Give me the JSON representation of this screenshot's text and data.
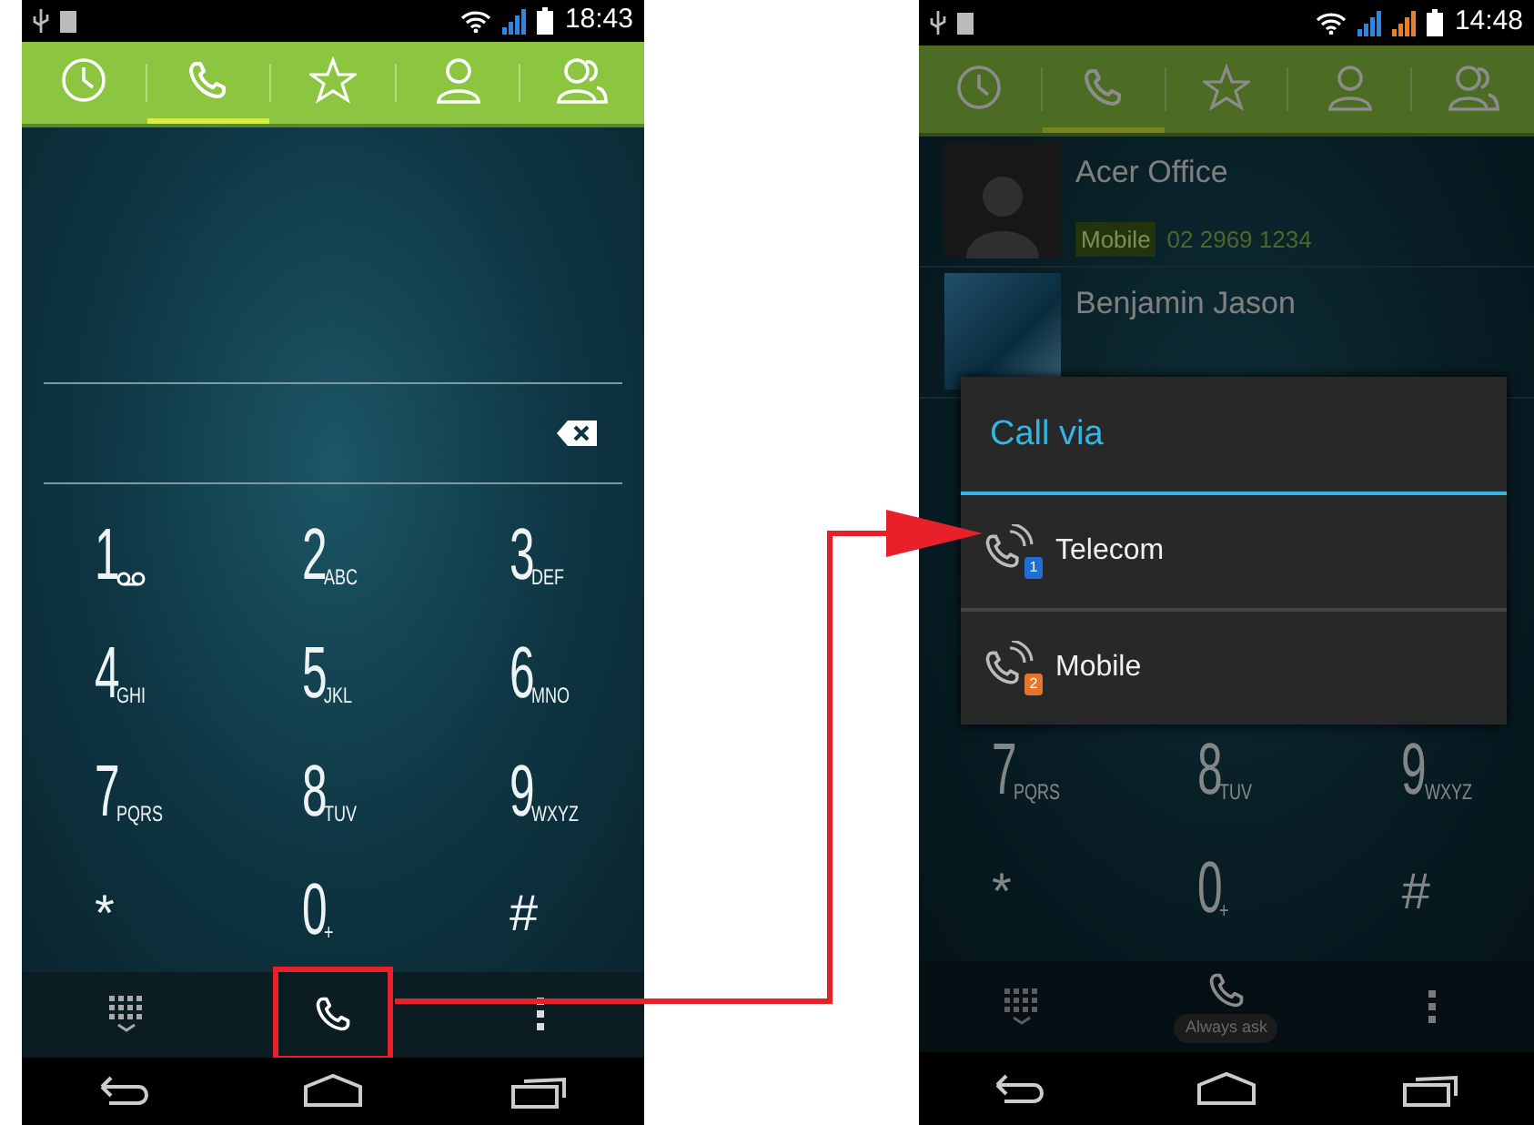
{
  "phones": [
    {
      "dimmed": false,
      "status_bar": {
        "time": "18:43",
        "signals": [
          {
            "color": "#2f86e0"
          }
        ]
      },
      "tabs": [
        {
          "kind": "recent",
          "selected": false
        },
        {
          "kind": "phone",
          "selected": true
        },
        {
          "kind": "favorites",
          "selected": false
        },
        {
          "kind": "contact",
          "selected": false
        },
        {
          "kind": "group",
          "selected": false
        }
      ],
      "keypad": [
        {
          "kind": "voicemail",
          "digit": "1"
        },
        {
          "kind": "letters",
          "digit": "2",
          "letters": "ABC"
        },
        {
          "kind": "letters",
          "digit": "3",
          "letters": "DEF"
        },
        {
          "kind": "letters",
          "digit": "4",
          "letters": "GHI"
        },
        {
          "kind": "letters",
          "digit": "5",
          "letters": "JKL"
        },
        {
          "kind": "letters",
          "digit": "6",
          "letters": "MNO"
        },
        {
          "kind": "letters",
          "digit": "7",
          "letters": "PQRS"
        },
        {
          "kind": "letters",
          "digit": "8",
          "letters": "TUV"
        },
        {
          "kind": "letters",
          "digit": "9",
          "letters": "WXYZ"
        },
        {
          "kind": "symbol",
          "digit": "*"
        },
        {
          "kind": "letters",
          "digit": "0",
          "letters": "+"
        },
        {
          "kind": "symbol",
          "digit": "#"
        }
      ],
      "action_bar": {
        "call_highlighted": true
      }
    },
    {
      "dimmed": true,
      "status_bar": {
        "time": "14:48",
        "signals": [
          {
            "color": "#2f86e0"
          },
          {
            "color": "#e8802a"
          }
        ]
      },
      "tabs": [
        {
          "kind": "recent",
          "selected": false
        },
        {
          "kind": "phone",
          "selected": true
        },
        {
          "kind": "favorites",
          "selected": false
        },
        {
          "kind": "contact",
          "selected": false
        },
        {
          "kind": "group",
          "selected": false
        }
      ],
      "contacts": [
        {
          "kind": "avatar",
          "name": "Acer Office",
          "label": "Mobile",
          "number": "02 2969 1234"
        },
        {
          "kind": "photo",
          "name": "Benjamin Jason"
        }
      ],
      "dialog": {
        "title": "Call via",
        "options": [
          {
            "label": "Telecom",
            "sim": "1",
            "color": "#1f6fd6"
          },
          {
            "label": "Mobile",
            "sim": "2",
            "color": "#e2762a"
          }
        ]
      },
      "keypad": [
        {
          "kind": "letters",
          "digit": "7",
          "letters": "PQRS"
        },
        {
          "kind": "letters",
          "digit": "8",
          "letters": "TUV"
        },
        {
          "kind": "letters",
          "digit": "9",
          "letters": "WXYZ"
        },
        {
          "kind": "symbol",
          "digit": "*"
        },
        {
          "kind": "letters",
          "digit": "0",
          "letters": "+"
        },
        {
          "kind": "symbol",
          "digit": "#"
        }
      ],
      "action_bar": {
        "call_highlighted": false,
        "caption": "Always ask"
      }
    }
  ]
}
